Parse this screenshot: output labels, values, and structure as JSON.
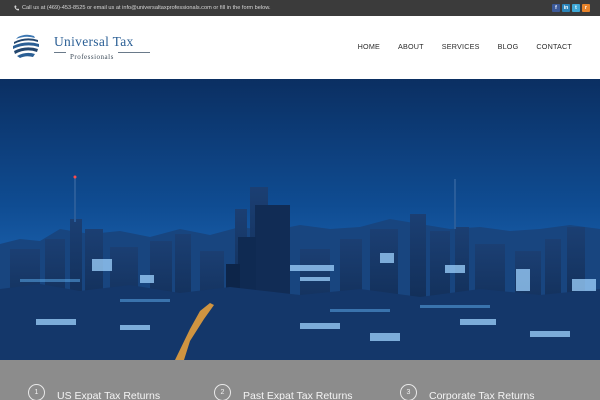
{
  "topbar": {
    "contact_text": "Call us at (469)-453-8525 or email us at info@universaltaxprofessionals.com or fill in the form below.",
    "social_icons": [
      "facebook-icon",
      "linkedin-icon",
      "twitter-icon",
      "rss-icon"
    ]
  },
  "logo": {
    "title": "Universal Tax",
    "subtitle": "Professionals"
  },
  "nav": {
    "items": [
      "HOME",
      "ABOUT",
      "SERVICES",
      "BLOG",
      "CONTACT"
    ]
  },
  "hero": {
    "description_icon": "city-skyline-night-image"
  },
  "services": {
    "items": [
      {
        "number": "1",
        "label": "US Expat Tax Returns"
      },
      {
        "number": "2",
        "label": "Past Expat Tax Returns"
      },
      {
        "number": "3",
        "label": "Corporate Tax Returns"
      }
    ]
  },
  "colors": {
    "topbar_bg": "#3b3b3b",
    "brand_blue": "#2b5f95",
    "services_bg": "#8c8c8c"
  }
}
